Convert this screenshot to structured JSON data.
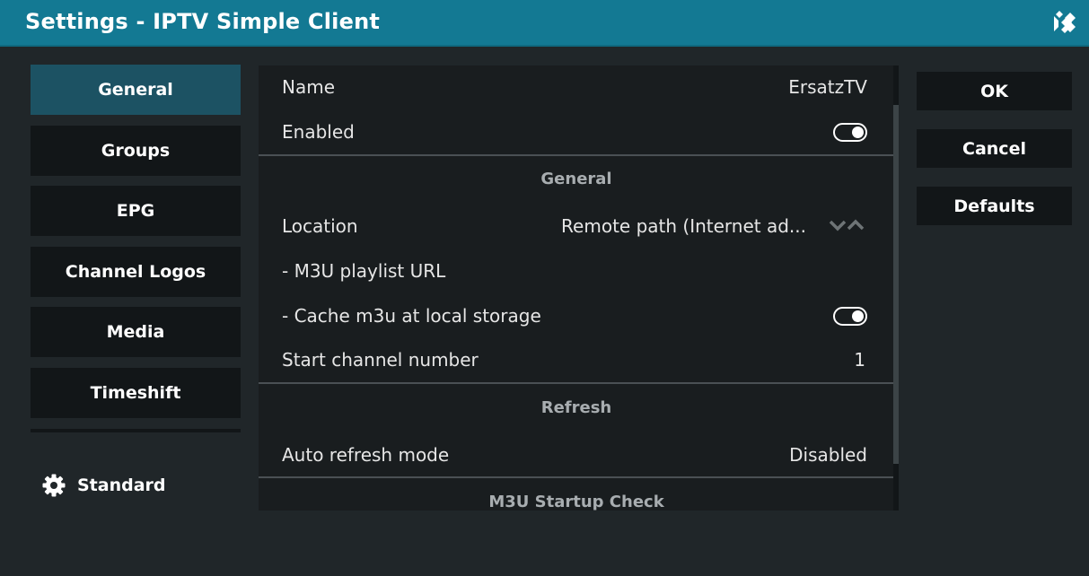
{
  "window": {
    "title": "Settings - IPTV Simple Client"
  },
  "categories": [
    {
      "label": "General",
      "active": true
    },
    {
      "label": "Groups"
    },
    {
      "label": "EPG"
    },
    {
      "label": "Channel Logos"
    },
    {
      "label": "Media"
    },
    {
      "label": "Timeshift"
    }
  ],
  "settings_level": {
    "label": "Standard",
    "icon": "gear-icon"
  },
  "settings": {
    "name": {
      "label": "Name",
      "value": "ErsatzTV"
    },
    "enabled": {
      "label": "Enabled",
      "state": "on"
    },
    "general_header": "General",
    "location": {
      "label": "Location",
      "value": "Remote path (Internet ad..."
    },
    "m3u_url": {
      "label": "- M3U playlist URL"
    },
    "cache_m3u": {
      "label": "- Cache m3u at local storage",
      "state": "on"
    },
    "start_channel": {
      "label": "Start channel number",
      "value": "1"
    },
    "refresh_header": "Refresh",
    "auto_refresh": {
      "label": "Auto refresh mode",
      "value": "Disabled"
    },
    "startup_check_header": "M3U Startup Check"
  },
  "buttons": {
    "ok": "OK",
    "cancel": "Cancel",
    "defaults": "Defaults"
  },
  "colors": {
    "titlebar": "#137993",
    "active_category": "#1c5263",
    "background": "#202629"
  }
}
